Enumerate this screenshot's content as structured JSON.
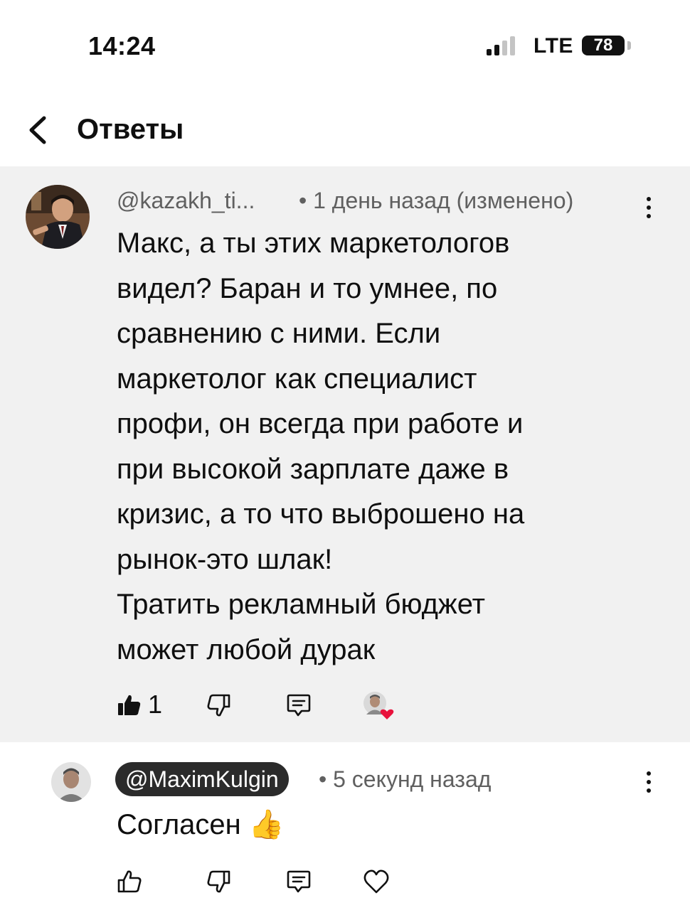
{
  "status_bar": {
    "time": "14:24",
    "network": "LTE",
    "battery": "78"
  },
  "header": {
    "title": "Ответы"
  },
  "parent_comment": {
    "author": "@kazakh_ti...",
    "timestamp": "• 1 день назад (изменено)",
    "text_lines": [
      "Макс, а ты этих маркетологов",
      "видел? Баран и то умнее, по",
      "сравнению с ними. Если",
      "маркетолог как специалист",
      "профи, он всегда при работе и",
      "при высокой зарплате даже в",
      "кризис, а то что выброшено на",
      "рынок-это шлак!",
      "Тратить рекламный бюджет",
      "может любой дурак"
    ],
    "like_count": "1"
  },
  "reply": {
    "author": "@MaximKulgin",
    "timestamp": "• 5 секунд назад",
    "text": "Согласен",
    "emoji": "👍"
  }
}
